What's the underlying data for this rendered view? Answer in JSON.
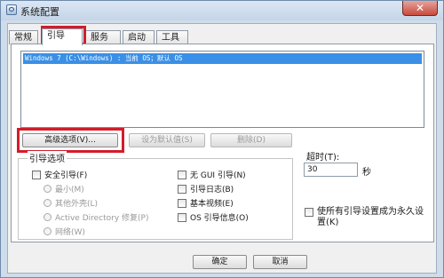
{
  "window": {
    "title": "系统配置",
    "close_symbol": "✕"
  },
  "tabs": [
    {
      "label": "常规"
    },
    {
      "label": "引导"
    },
    {
      "label": "服务"
    },
    {
      "label": "启动"
    },
    {
      "label": "工具"
    }
  ],
  "boot_list": {
    "items": [
      {
        "label": "Windows 7 (C:\\Windows) : 当前 OS；默认 OS",
        "selected": true
      }
    ]
  },
  "buttons": {
    "advanced": "高级选项(V)...",
    "set_default": "设为默认值(S)",
    "delete": "删除(D)",
    "ok": "确定",
    "cancel": "取消"
  },
  "boot_options": {
    "label": "引导选项",
    "safe_boot": "安全引导(F)",
    "minimal": "最小(M)",
    "alternate_shell": "其他外壳(L)",
    "active_directory": "Active Directory 修复(P)",
    "network": "网络(W)",
    "no_gui": "无 GUI 引导(N)",
    "boot_log": "引导日志(B)",
    "base_video": "基本视频(E)",
    "os_boot_info": "OS 引导信息(O)"
  },
  "timeout": {
    "label": "超时(T):",
    "value": "30",
    "unit": "秒"
  },
  "persist": {
    "label": "使所有引导设置成为永久设置(K)"
  },
  "colors": {
    "highlight": "#d31c2a",
    "selection": "#3a8fe6"
  }
}
